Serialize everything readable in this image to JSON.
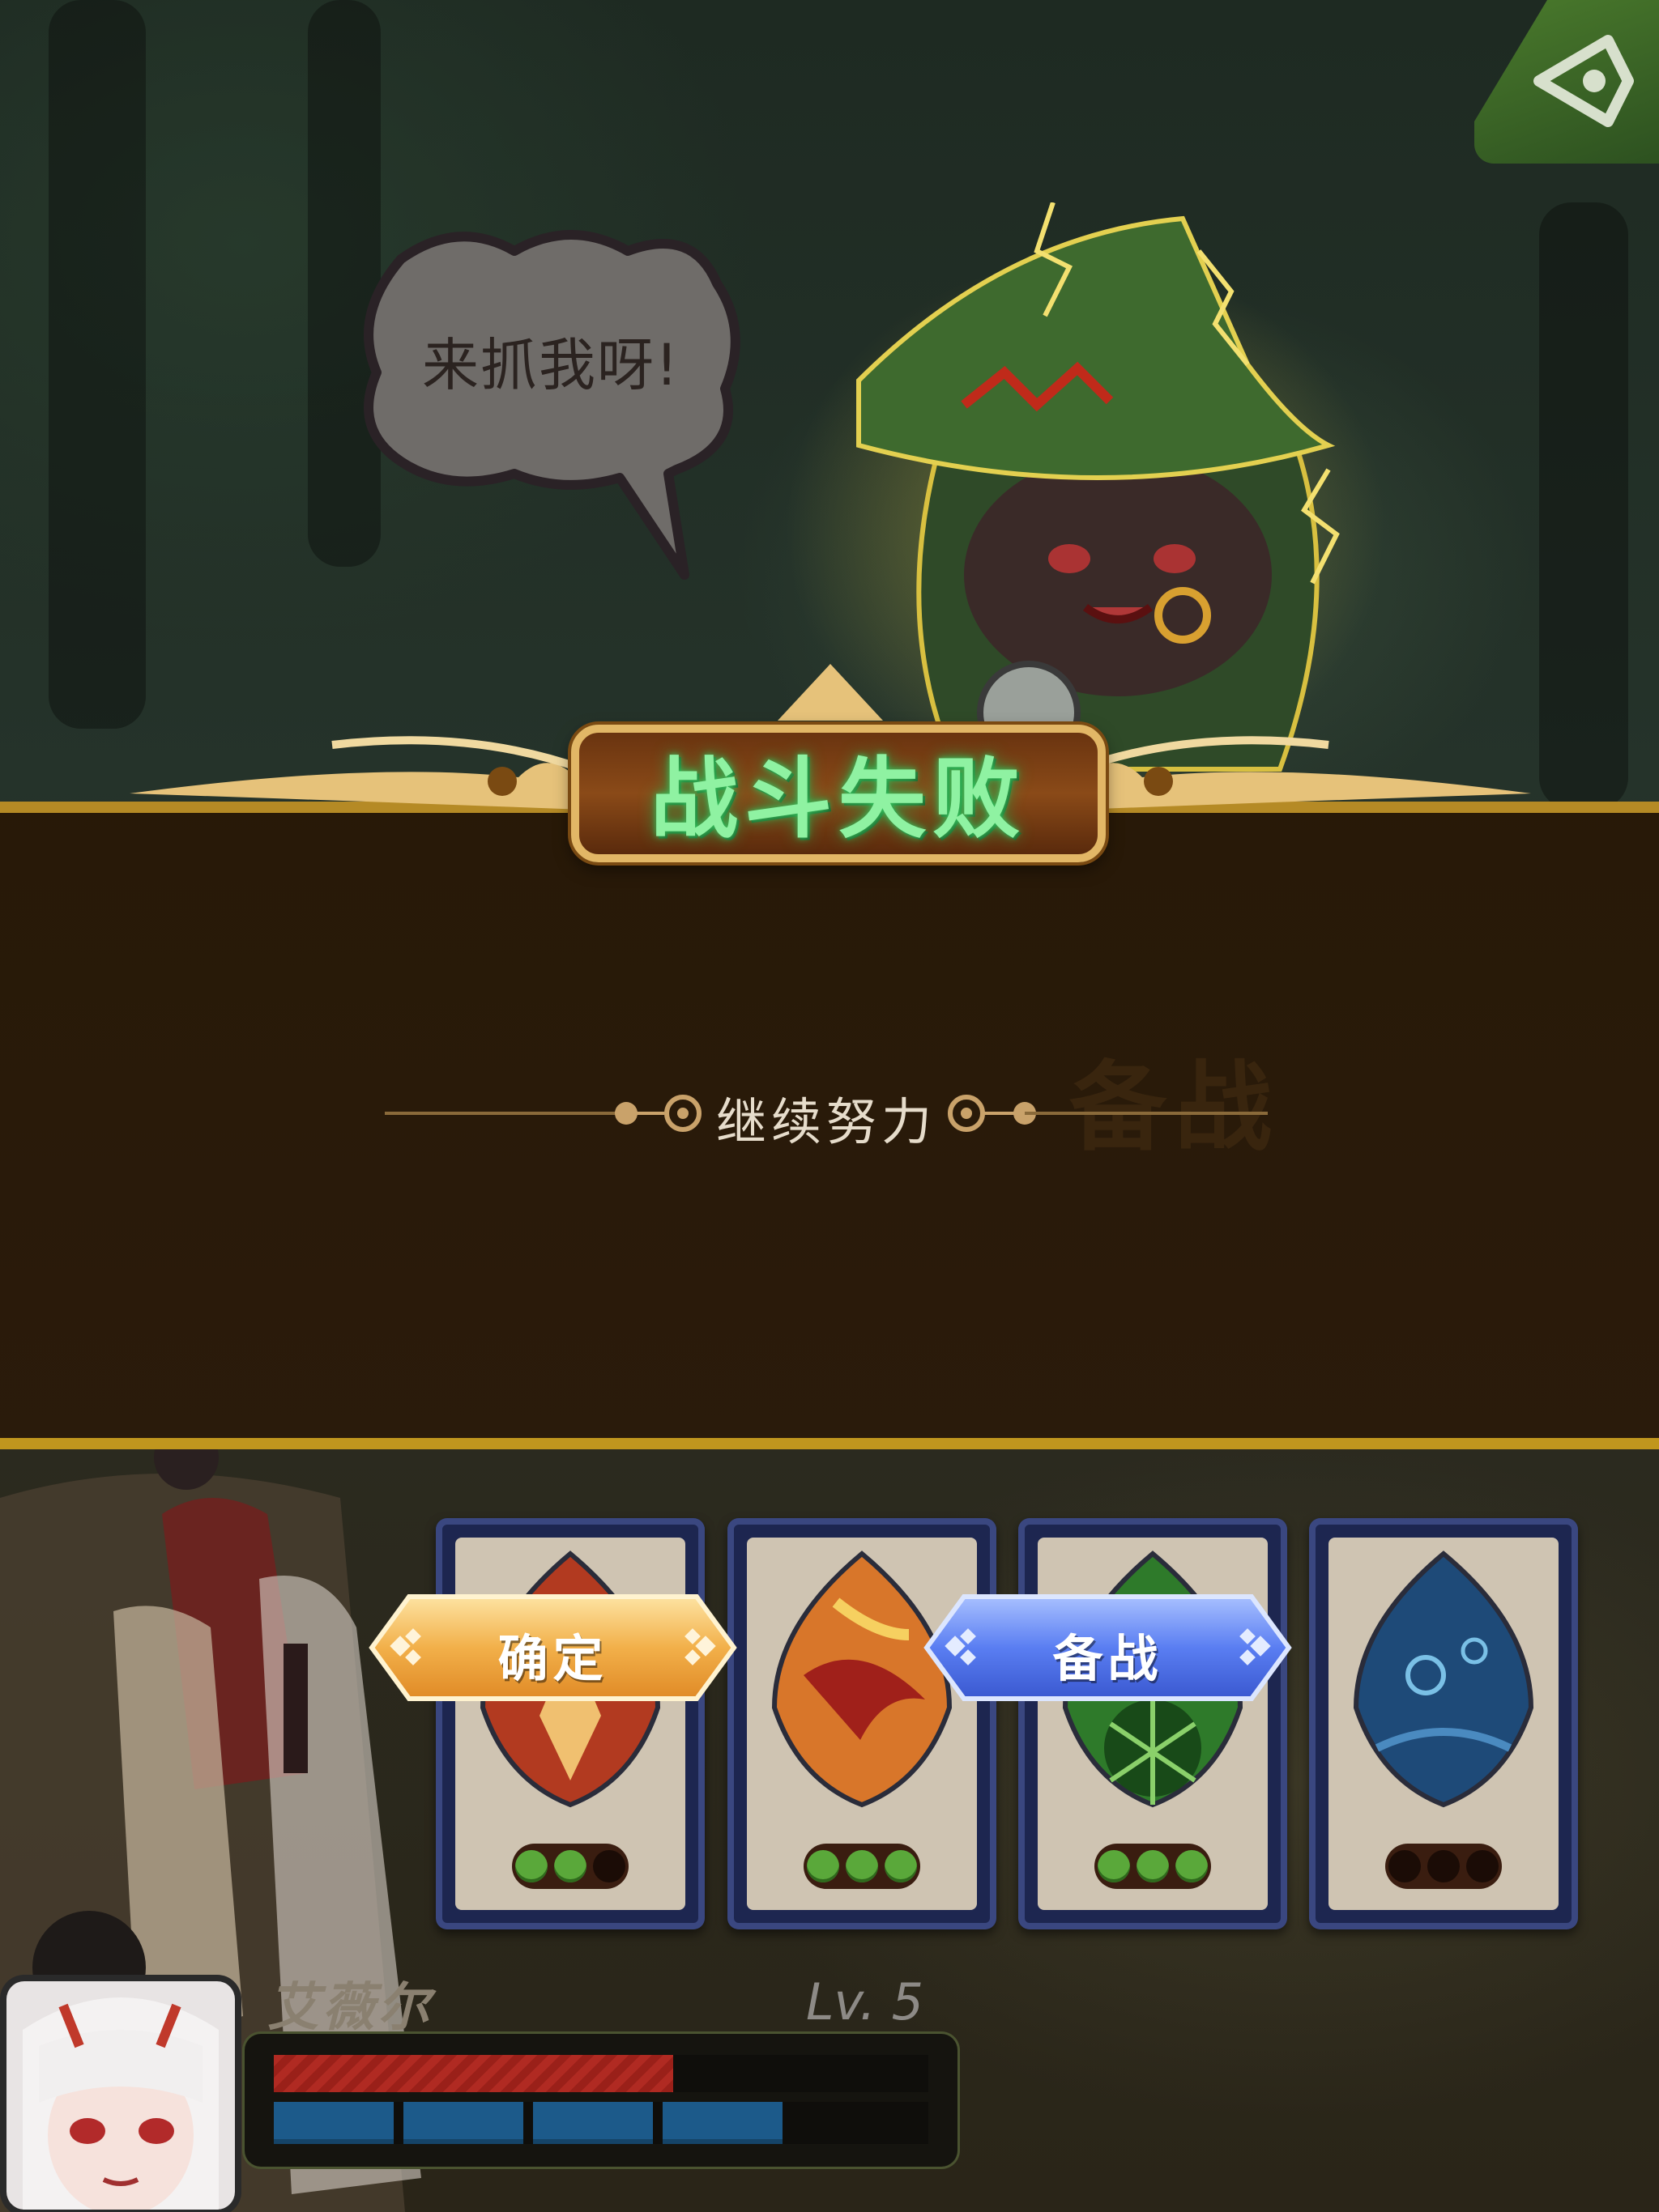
{
  "speech_bubble": {
    "text": "来抓我呀!"
  },
  "result": {
    "title": "战斗失败",
    "subtitle": "继续努力",
    "background_watermark": "备战"
  },
  "buttons": {
    "confirm_label": "确定",
    "prepare_label": "备战"
  },
  "skill_cards": [
    {
      "element": "fire",
      "pips": [
        true,
        true,
        false
      ]
    },
    {
      "element": "flame",
      "pips": [
        true,
        true,
        true
      ]
    },
    {
      "element": "nature",
      "pips": [
        true,
        true,
        true
      ]
    },
    {
      "element": "water",
      "pips": [
        false,
        false,
        false
      ]
    }
  ],
  "hero": {
    "name": "艾薇尔",
    "level": "Lv. 5",
    "hp_fraction": 0.61,
    "mp_segments_filled": 4,
    "mp_segments_total": 5
  },
  "colors": {
    "title_glow": "#8ff2a2",
    "band_border": "#b58a25",
    "confirm_button": "#f0a440",
    "prepare_button": "#4a6ff0",
    "hp": "#b02a22",
    "mp": "#1c5a8a"
  },
  "icons": {
    "corner": "hide-ui-eye-icon"
  }
}
